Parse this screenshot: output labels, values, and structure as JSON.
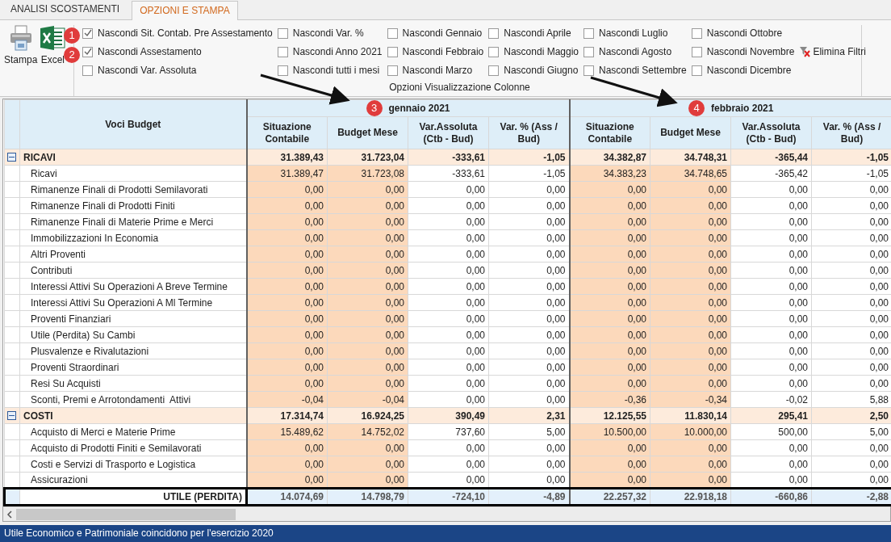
{
  "tabs": [
    {
      "label": "ANALISI SCOSTAMENTI",
      "selected": false
    },
    {
      "label": "OPZIONI E STAMPA",
      "selected": true
    }
  ],
  "ribbon": {
    "buttons": [
      {
        "kind": "print",
        "label": "Stampa"
      },
      {
        "kind": "excel",
        "label": "Excel"
      }
    ],
    "badges": [
      "1",
      "2"
    ],
    "checkboxes": [
      {
        "label": "Nascondi Sit. Contab. Pre Assestamento",
        "checked": true
      },
      {
        "label": "Nascondi Assestamento",
        "checked": true
      },
      {
        "label": "Nascondi Var. Assoluta",
        "checked": false
      },
      {
        "label": "Nascondi Var. %",
        "checked": false
      },
      {
        "label": "Nascondi Anno 2021",
        "checked": false
      },
      {
        "label": "Nascondi tutti i mesi",
        "checked": false
      },
      {
        "label": "Nascondi Gennaio",
        "checked": false
      },
      {
        "label": "Nascondi Febbraio",
        "checked": false
      },
      {
        "label": "Nascondi Marzo",
        "checked": false
      },
      {
        "label": "Nascondi Aprile",
        "checked": false
      },
      {
        "label": "Nascondi Maggio",
        "checked": false
      },
      {
        "label": "Nascondi Giugno",
        "checked": false
      },
      {
        "label": "Nascondi Luglio",
        "checked": false
      },
      {
        "label": "Nascondi Agosto",
        "checked": false
      },
      {
        "label": "Nascondi Settembre",
        "checked": false
      },
      {
        "label": "Nascondi Ottobre",
        "checked": false
      },
      {
        "label": "Nascondi Novembre",
        "checked": false
      },
      {
        "label": "Nascondi Dicembre",
        "checked": false
      }
    ],
    "clear_filters": "Elimina Filtri",
    "group_label": "Opzioni Visualizzazione Colonne"
  },
  "table": {
    "first_column": "Voci Budget",
    "months": [
      {
        "title": "gennaio 2021",
        "badge": "3",
        "columns": [
          {
            "label": "Situazione Contabile",
            "highlighted": true
          },
          {
            "label": "Budget Mese",
            "highlighted": true
          },
          {
            "label": "Var.Assoluta (Ctb - Bud)",
            "highlighted": false
          },
          {
            "label": "Var. % (Ass / Bud)",
            "highlighted": false
          }
        ]
      },
      {
        "title": "febbraio 2021",
        "badge": "4",
        "columns": [
          {
            "label": "Situazione Contabile",
            "highlighted": true
          },
          {
            "label": "Budget Mese",
            "highlighted": true
          },
          {
            "label": "Var.Assoluta (Ctb - Bud)",
            "highlighted": false
          },
          {
            "label": "Var. % (Ass / Bud)",
            "highlighted": false
          }
        ]
      }
    ],
    "groups": [
      {
        "label": "RICAVI",
        "expanded": true,
        "values": [
          "31.389,43",
          "31.723,04",
          "-333,61",
          "-1,05",
          "34.382,87",
          "34.748,31",
          "-365,44",
          "-1,05"
        ],
        "children": [
          {
            "label": "Ricavi",
            "values": [
              "31.389,47",
              "31.723,08",
              "-333,61",
              "-1,05",
              "34.383,23",
              "34.748,65",
              "-365,42",
              "-1,05"
            ]
          },
          {
            "label": "Rimanenze Finali di Prodotti Semilavorati",
            "values": [
              "0,00",
              "0,00",
              "0,00",
              "0,00",
              "0,00",
              "0,00",
              "0,00",
              "0,00"
            ]
          },
          {
            "label": "Rimanenze Finali di Prodotti Finiti",
            "values": [
              "0,00",
              "0,00",
              "0,00",
              "0,00",
              "0,00",
              "0,00",
              "0,00",
              "0,00"
            ]
          },
          {
            "label": "Rimanenze Finali di Materie Prime e Merci",
            "values": [
              "0,00",
              "0,00",
              "0,00",
              "0,00",
              "0,00",
              "0,00",
              "0,00",
              "0,00"
            ]
          },
          {
            "label": "Immobilizzazioni In Economia",
            "values": [
              "0,00",
              "0,00",
              "0,00",
              "0,00",
              "0,00",
              "0,00",
              "0,00",
              "0,00"
            ]
          },
          {
            "label": "Altri Proventi",
            "values": [
              "0,00",
              "0,00",
              "0,00",
              "0,00",
              "0,00",
              "0,00",
              "0,00",
              "0,00"
            ]
          },
          {
            "label": "Contributi",
            "values": [
              "0,00",
              "0,00",
              "0,00",
              "0,00",
              "0,00",
              "0,00",
              "0,00",
              "0,00"
            ]
          },
          {
            "label": "Interessi Attivi Su Operazioni A Breve Termine",
            "values": [
              "0,00",
              "0,00",
              "0,00",
              "0,00",
              "0,00",
              "0,00",
              "0,00",
              "0,00"
            ]
          },
          {
            "label": "Interessi Attivi Su Operazioni A Ml Termine",
            "values": [
              "0,00",
              "0,00",
              "0,00",
              "0,00",
              "0,00",
              "0,00",
              "0,00",
              "0,00"
            ]
          },
          {
            "label": "Proventi Finanziari",
            "values": [
              "0,00",
              "0,00",
              "0,00",
              "0,00",
              "0,00",
              "0,00",
              "0,00",
              "0,00"
            ]
          },
          {
            "label": "Utile (Perdita) Su Cambi",
            "values": [
              "0,00",
              "0,00",
              "0,00",
              "0,00",
              "0,00",
              "0,00",
              "0,00",
              "0,00"
            ]
          },
          {
            "label": "Plusvalenze e Rivalutazioni",
            "values": [
              "0,00",
              "0,00",
              "0,00",
              "0,00",
              "0,00",
              "0,00",
              "0,00",
              "0,00"
            ]
          },
          {
            "label": "Proventi Straordinari",
            "values": [
              "0,00",
              "0,00",
              "0,00",
              "0,00",
              "0,00",
              "0,00",
              "0,00",
              "0,00"
            ]
          },
          {
            "label": "Resi Su Acquisti",
            "values": [
              "0,00",
              "0,00",
              "0,00",
              "0,00",
              "0,00",
              "0,00",
              "0,00",
              "0,00"
            ]
          },
          {
            "label": "Sconti, Premi e Arrotondamenti  Attivi",
            "values": [
              "-0,04",
              "-0,04",
              "0,00",
              "0,00",
              "-0,36",
              "-0,34",
              "-0,02",
              "5,88"
            ]
          }
        ]
      },
      {
        "label": "COSTI",
        "expanded": true,
        "values": [
          "17.314,74",
          "16.924,25",
          "390,49",
          "2,31",
          "12.125,55",
          "11.830,14",
          "295,41",
          "2,50"
        ],
        "children": [
          {
            "label": "Acquisto di Merci e Materie Prime",
            "values": [
              "15.489,62",
              "14.752,02",
              "737,60",
              "5,00",
              "10.500,00",
              "10.000,00",
              "500,00",
              "5,00"
            ]
          },
          {
            "label": "Acquisto di Prodotti Finiti e Semilavorati",
            "values": [
              "0,00",
              "0,00",
              "0,00",
              "0,00",
              "0,00",
              "0,00",
              "0,00",
              "0,00"
            ]
          },
          {
            "label": "Costi e Servizi di Trasporto e Logistica",
            "values": [
              "0,00",
              "0,00",
              "0,00",
              "0,00",
              "0,00",
              "0,00",
              "0,00",
              "0,00"
            ]
          },
          {
            "label": "Assicurazioni",
            "values": [
              "0,00",
              "0,00",
              "0,00",
              "0,00",
              "0,00",
              "0,00",
              "0,00",
              "0,00"
            ]
          }
        ]
      }
    ],
    "total": {
      "label": "UTILE (PERDITA)",
      "values": [
        "14.074,69",
        "14.798,79",
        "-724,10",
        "-4,89",
        "22.257,32",
        "22.918,18",
        "-660,86",
        "-2,88"
      ]
    }
  },
  "status_bar": "Utile Economico e Patrimoniale coincidono per l'esercizio 2020"
}
